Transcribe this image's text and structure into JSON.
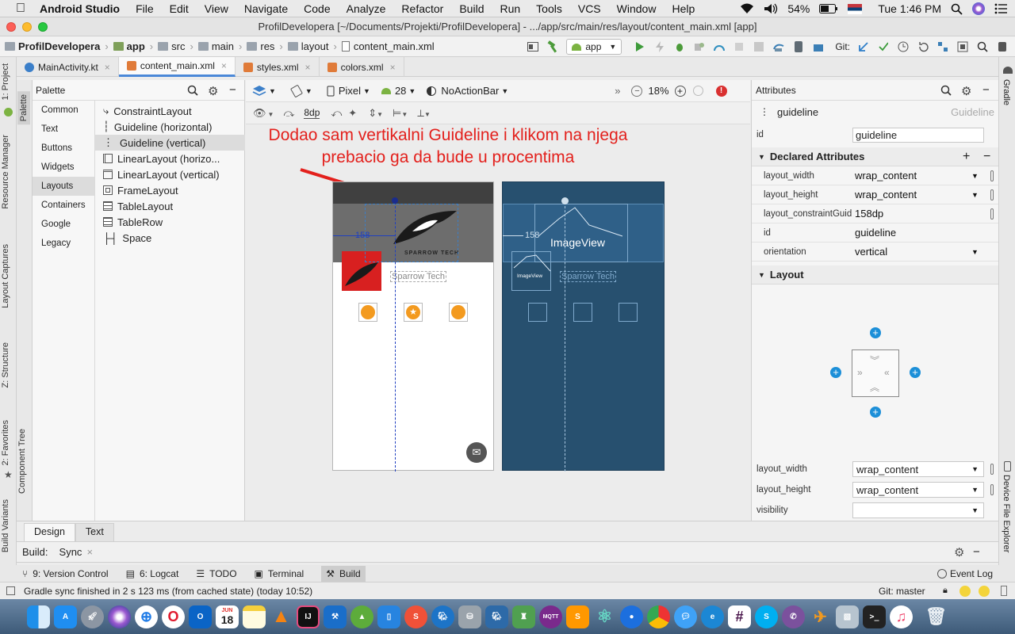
{
  "menubar": {
    "app_name": "Android Studio",
    "items": [
      "File",
      "Edit",
      "View",
      "Navigate",
      "Code",
      "Analyze",
      "Refactor",
      "Build",
      "Run",
      "Tools",
      "VCS",
      "Window",
      "Help"
    ],
    "battery": "54%",
    "clock": "Tue 1:46 PM"
  },
  "window": {
    "title": "ProfilDevelopera [~/Documents/Projekti/ProfilDevelopera] - .../app/src/main/res/layout/content_main.xml [app]"
  },
  "breadcrumb": [
    "ProfilDevelopera",
    "app",
    "src",
    "main",
    "res",
    "layout",
    "content_main.xml"
  ],
  "run_config": "app",
  "git_label": "Git:",
  "editor_tabs": [
    {
      "label": "MainActivity.kt",
      "active": false
    },
    {
      "label": "content_main.xml",
      "active": true
    },
    {
      "label": "styles.xml",
      "active": false
    },
    {
      "label": "colors.xml",
      "active": false
    }
  ],
  "left_tool_windows": [
    "1: Project",
    "Resource Manager",
    "Layout Captures",
    "Z: Structure",
    "2: Favorites",
    "Build Variants"
  ],
  "palette_strip": [
    "Palette",
    "Component Tree"
  ],
  "right_tool_windows": [
    "Gradle",
    "Device File Explorer"
  ],
  "palette": {
    "title": "Palette",
    "categories": [
      {
        "label": "Common",
        "selected": false
      },
      {
        "label": "Text",
        "selected": false
      },
      {
        "label": "Buttons",
        "selected": false
      },
      {
        "label": "Widgets",
        "selected": false
      },
      {
        "label": "Layouts",
        "selected": true
      },
      {
        "label": "Containers",
        "selected": false
      },
      {
        "label": "Google",
        "selected": false
      },
      {
        "label": "Legacy",
        "selected": false
      }
    ],
    "items": [
      {
        "label": "ConstraintLayout",
        "selected": false
      },
      {
        "label": "Guideline (horizontal)",
        "selected": false
      },
      {
        "label": "Guideline (vertical)",
        "selected": true
      },
      {
        "label": "LinearLayout (horizo...",
        "selected": false
      },
      {
        "label": "LinearLayout (vertical)",
        "selected": false
      },
      {
        "label": "FrameLayout",
        "selected": false
      },
      {
        "label": "TableLayout",
        "selected": false
      },
      {
        "label": "TableRow",
        "selected": false
      },
      {
        "label": "Space",
        "selected": false
      }
    ]
  },
  "design_toolbar": {
    "device": "Pixel",
    "api": "28",
    "theme": "NoActionBar",
    "zoom": "18%",
    "margin": "8dp"
  },
  "canvas": {
    "annotation": "Dodao sam vertikalni Guideline i klikom na njega prebacio ga da bude u procentima",
    "guide_value": "158",
    "logo_text": "SPARROW TECH",
    "name_text": "Sparrow Tech",
    "blueprint_image_label": "ImageView",
    "blueprint_small_label": "ImageView",
    "blueprint_name": "Sparrow Tech",
    "blueprint_guide_value": "158"
  },
  "attributes": {
    "title": "Attributes",
    "component_id": "guideline",
    "component_type": "Guideline",
    "id_label": "id",
    "id_value": "guideline",
    "declared_header": "Declared Attributes",
    "declared": [
      {
        "name": "layout_width",
        "value": "wrap_content"
      },
      {
        "name": "layout_height",
        "value": "wrap_content"
      },
      {
        "name": "layout_constraintGuid",
        "value": "158dp"
      },
      {
        "name": "id",
        "value": "guideline"
      },
      {
        "name": "orientation",
        "value": "vertical"
      }
    ],
    "layout_header": "Layout",
    "layout_rows": [
      {
        "name": "layout_width",
        "value": "wrap_content"
      },
      {
        "name": "layout_height",
        "value": "wrap_content"
      },
      {
        "name": "visibility",
        "value": ""
      }
    ]
  },
  "design_tabs": [
    "Design",
    "Text"
  ],
  "build_panel": {
    "label": "Build:",
    "tab": "Sync"
  },
  "bottom_tools": [
    "9: Version Control",
    "6: Logcat",
    "TODO",
    "Terminal",
    "Build"
  ],
  "event_log": "Event Log",
  "status": {
    "message": "Gradle sync finished in 2 s 123 ms (from cached state) (today 10:52)",
    "git": "Git: master"
  },
  "dock_calendar": {
    "month": "JUN",
    "day": "18"
  }
}
